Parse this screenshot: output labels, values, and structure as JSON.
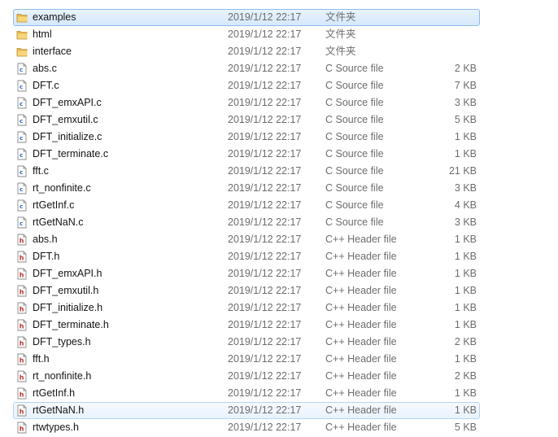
{
  "colors": {
    "selection_fill": "#d6e8fb",
    "selection_border": "#8fbcea",
    "folder": "#e8b84a",
    "header_icon_accent": "#b8312f",
    "source_icon_accent": "#2a66c4"
  },
  "files": [
    {
      "name": "examples",
      "date": "2019/1/12 22:17",
      "type": "文件夹",
      "size": "",
      "icon": "folder-icon",
      "state": "selected"
    },
    {
      "name": "html",
      "date": "2019/1/12 22:17",
      "type": "文件夹",
      "size": "",
      "icon": "folder-icon"
    },
    {
      "name": "interface",
      "date": "2019/1/12 22:17",
      "type": "文件夹",
      "size": "",
      "icon": "folder-icon"
    },
    {
      "name": "abs.c",
      "date": "2019/1/12 22:17",
      "type": "C Source file",
      "size": "2 KB",
      "icon": "c-source-file-icon"
    },
    {
      "name": "DFT.c",
      "date": "2019/1/12 22:17",
      "type": "C Source file",
      "size": "7 KB",
      "icon": "c-source-file-icon"
    },
    {
      "name": "DFT_emxAPI.c",
      "date": "2019/1/12 22:17",
      "type": "C Source file",
      "size": "3 KB",
      "icon": "c-source-file-icon"
    },
    {
      "name": "DFT_emxutil.c",
      "date": "2019/1/12 22:17",
      "type": "C Source file",
      "size": "5 KB",
      "icon": "c-source-file-icon"
    },
    {
      "name": "DFT_initialize.c",
      "date": "2019/1/12 22:17",
      "type": "C Source file",
      "size": "1 KB",
      "icon": "c-source-file-icon"
    },
    {
      "name": "DFT_terminate.c",
      "date": "2019/1/12 22:17",
      "type": "C Source file",
      "size": "1 KB",
      "icon": "c-source-file-icon"
    },
    {
      "name": "fft.c",
      "date": "2019/1/12 22:17",
      "type": "C Source file",
      "size": "21 KB",
      "icon": "c-source-file-icon"
    },
    {
      "name": "rt_nonfinite.c",
      "date": "2019/1/12 22:17",
      "type": "C Source file",
      "size": "3 KB",
      "icon": "c-source-file-icon"
    },
    {
      "name": "rtGetInf.c",
      "date": "2019/1/12 22:17",
      "type": "C Source file",
      "size": "4 KB",
      "icon": "c-source-file-icon"
    },
    {
      "name": "rtGetNaN.c",
      "date": "2019/1/12 22:17",
      "type": "C Source file",
      "size": "3 KB",
      "icon": "c-source-file-icon"
    },
    {
      "name": "abs.h",
      "date": "2019/1/12 22:17",
      "type": "C++ Header file",
      "size": "1 KB",
      "icon": "header-file-icon"
    },
    {
      "name": "DFT.h",
      "date": "2019/1/12 22:17",
      "type": "C++ Header file",
      "size": "1 KB",
      "icon": "header-file-icon"
    },
    {
      "name": "DFT_emxAPI.h",
      "date": "2019/1/12 22:17",
      "type": "C++ Header file",
      "size": "1 KB",
      "icon": "header-file-icon"
    },
    {
      "name": "DFT_emxutil.h",
      "date": "2019/1/12 22:17",
      "type": "C++ Header file",
      "size": "1 KB",
      "icon": "header-file-icon"
    },
    {
      "name": "DFT_initialize.h",
      "date": "2019/1/12 22:17",
      "type": "C++ Header file",
      "size": "1 KB",
      "icon": "header-file-icon"
    },
    {
      "name": "DFT_terminate.h",
      "date": "2019/1/12 22:17",
      "type": "C++ Header file",
      "size": "1 KB",
      "icon": "header-file-icon"
    },
    {
      "name": "DFT_types.h",
      "date": "2019/1/12 22:17",
      "type": "C++ Header file",
      "size": "2 KB",
      "icon": "header-file-icon"
    },
    {
      "name": "fft.h",
      "date": "2019/1/12 22:17",
      "type": "C++ Header file",
      "size": "1 KB",
      "icon": "header-file-icon"
    },
    {
      "name": "rt_nonfinite.h",
      "date": "2019/1/12 22:17",
      "type": "C++ Header file",
      "size": "2 KB",
      "icon": "header-file-icon"
    },
    {
      "name": "rtGetInf.h",
      "date": "2019/1/12 22:17",
      "type": "C++ Header file",
      "size": "1 KB",
      "icon": "header-file-icon"
    },
    {
      "name": "rtGetNaN.h",
      "date": "2019/1/12 22:17",
      "type": "C++ Header file",
      "size": "1 KB",
      "icon": "header-file-icon",
      "state": "hovered"
    },
    {
      "name": "rtwtypes.h",
      "date": "2019/1/12 22:17",
      "type": "C++ Header file",
      "size": "5 KB",
      "icon": "header-file-icon"
    }
  ]
}
